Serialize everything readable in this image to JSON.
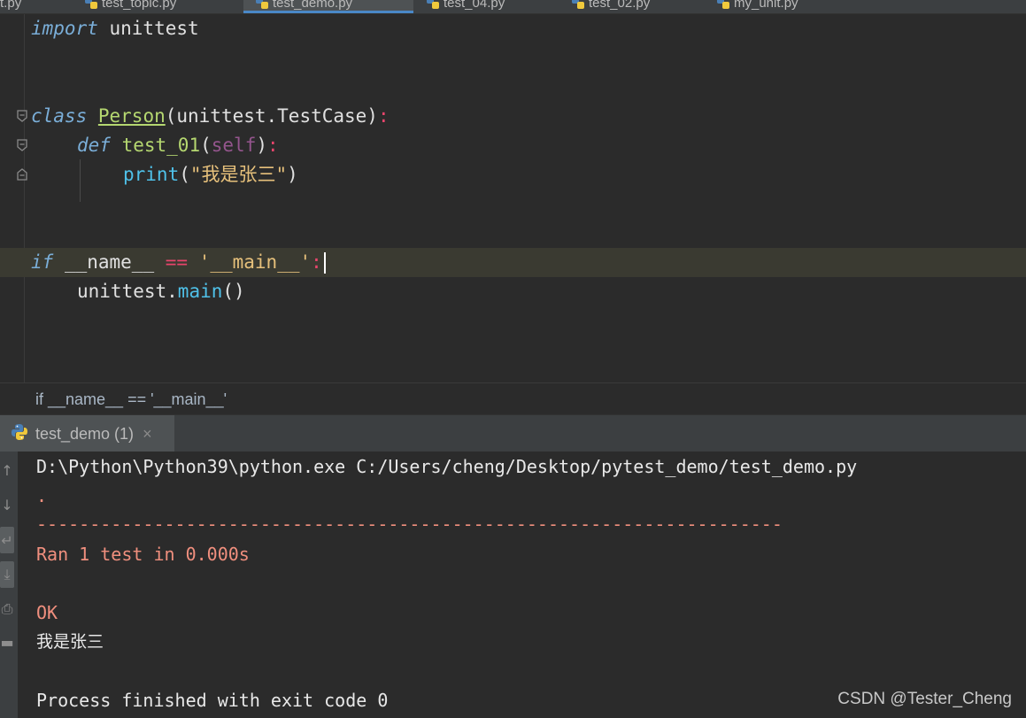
{
  "tabs": [
    {
      "label": "unit.py",
      "active": false
    },
    {
      "label": "test_topic.py",
      "active": false
    },
    {
      "label": "test_demo.py",
      "active": true
    },
    {
      "label": "test_04.py",
      "active": false
    },
    {
      "label": "test_02.py",
      "active": false
    },
    {
      "label": "my_unit.py",
      "active": false
    }
  ],
  "editor": {
    "line1": {
      "kw": "import",
      "rest": " unittest"
    },
    "line2": {
      "kw": "class",
      "name": "Person",
      "base": "(unittest.TestCase)",
      "colon": ":"
    },
    "line3": {
      "kw": "def",
      "name": "test_01",
      "open": "(",
      "self": "self",
      "close": ")",
      "colon": ":"
    },
    "line4": {
      "fn": "print",
      "open": "(",
      "str": "\"我是张三\"",
      "close": ")"
    },
    "line5": {
      "kw": "if",
      "a": " __name__ ",
      "op": "==",
      "sp": " ",
      "str": "'__main__'",
      "colon": ":"
    },
    "line6": {
      "obj": "unittest.",
      "meth": "main",
      "call": "()"
    }
  },
  "breadcrumb": "if __name__ == '__main__'",
  "run": {
    "tab_label": "test_demo (1)",
    "close": "×"
  },
  "console": {
    "cmd": "D:\\Python\\Python39\\python.exe C:/Users/cheng/Desktop/pytest_demo/test_demo.py",
    "dot": ".",
    "separator": "----------------------------------------------------------------------",
    "ran": "Ran 1 test in 0.000s",
    "ok": "OK",
    "output": "我是张三",
    "finished": "Process finished with exit code 0"
  },
  "watermark": "CSDN @Tester_Cheng",
  "colors": {
    "accent": "#4a88c7",
    "error": "#f08f7e",
    "keyword": "#7aaed8"
  }
}
